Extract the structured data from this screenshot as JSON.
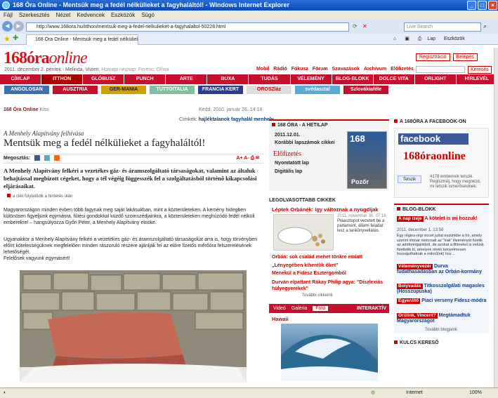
{
  "window": {
    "title": "168 Óra Online - Mentsük meg a fedél nélkülieket a fagyhaláltól! - Windows Internet Explorer"
  },
  "menu": [
    "Fájl",
    "Szerkesztés",
    "Nézet",
    "Kedvencek",
    "Eszközök",
    "Súgó"
  ],
  "address": {
    "url": "http://www.168ora.hu/itthon/mentsuk-meg-a-fedel-nelkulieket-a-fagyhalaltol-50228.html",
    "search_placeholder": "Live Search"
  },
  "tab": {
    "label": "168 Óra Online - Mentsük meg a fedél nélkülieket a fa..."
  },
  "toolbar": {
    "lap": "Lap",
    "eszkozok": "Eszközök"
  },
  "site": {
    "logo_main": "168óra",
    "logo_sub": "online",
    "dateline": "2011. december 2. péntek - Melinda, Vivien.",
    "namedays": "Holnapi névnap: Ferenc, Olívia",
    "top_links": [
      "Mobil",
      "Rádió",
      "Fókusz",
      "Fórum",
      "Szavazások",
      "Archívum",
      "Előfizetés"
    ],
    "regisztracio": "Regisztráció",
    "belepes": "Belépés",
    "kereses": "Keresés",
    "nav": [
      "CÍMLAP",
      "ITTHON",
      "GLÓBUSZ",
      "PUNCH",
      "ARTE",
      "BUXA",
      "TUDÁS",
      "VÉLEMÉNY",
      "BLOG-BLOKK",
      "DOLCE VITA",
      "ORLIGHT",
      "HÍRLEVÉL"
    ],
    "partners": [
      "ANGOLOSAN",
      "AUSZTRIA",
      "GER-MANIA",
      "TUTTOITALIA",
      "FRANCIA KERT",
      "OROSZláz",
      "svédasztal",
      "Szlovákiaféle"
    ]
  },
  "article": {
    "source": "168 Óra Online",
    "source_suffix": "Kiss",
    "datetime": "Kedd, 2010. január 26. 14:18",
    "cimkek_label": "Címkék:",
    "cimkek": "hajléktalanok fagyhalál menhely",
    "kicker": "A Menhely Alapítvány felhívása",
    "headline": "Mentsük meg a fedél nélkülieket a fagyhaláltól!",
    "share_label": "Megosztás:",
    "lead": "A Menhely Alapítvány felkéri a vezetékes gáz- és áramszolgáltató társaságokat, valamint az általuk behajtással megbízott cégeket, hogy a tél végéig függesszék fel a szolgáltatásból történő kikapcsolási eljárásaikat.",
    "more": "a cikk folytatódik a hirdetés után",
    "body1": "Magyarországon minden évben több fagynak meg saját lakásukban, mint a közterületeken. A kemény hidegben különösen figyeljünk egymásra, fűtési gondokkal küzdő szomszédjainkra, a közterületeken meghúzódó fedél nélküli emberekre! – hangsúlyozza Győri Péter, a Menhely Alapítvány elnöke.",
    "body2": "Ugyanakkor a Menhely Alapítvány felkéri a vezetékes gáz- és áramszolgáltató társaságokat arra is, hogy törvényben előírt kötelességüknek megfelelően minden rászoruló részére ajánlják fel az előre fizetős mérőóra felszerelésének lehetőségét.",
    "body3": "Felelősek vagyunk egymásért!"
  },
  "hetilap": {
    "title": "168 ÓRA - A HETILAP",
    "date": "2011.12.01.",
    "korabbi": "Korábbi lapszámok cikkei",
    "elofizetes": "Előfizetés",
    "nyomtatott": "Nyomtatott lap",
    "digitalis": "Digitális lap",
    "mag_title": "168",
    "mag_bottom": "Pozőr"
  },
  "legolvasottabb": {
    "title": "LEGOLVASOTTABB CIKKEK",
    "top_title": "Léptek Orbánék: így változnak a nyugdíjak",
    "top_date": "2011. november 30. 07:16",
    "top_text": "Pláasztopot vezetett be a parlament, állami feladat lesz a tankönyvellátás.",
    "items": [
      "Orbán: sok család mehet tönkre emiatt",
      "„Lényegében kiherélik őket”",
      "Menekül a Fidesz Esztergomból",
      "Durván elpattant Rákay Philip agya: \"Diszlexiás hülyegyerekek\""
    ],
    "tovabbi": "További cikkeink"
  },
  "media": {
    "tabs": [
      "Videó",
      "Galéria",
      "Fotó"
    ],
    "interaktiv": "INTERAKTÍV",
    "hawaii": "Hawaii"
  },
  "facebook": {
    "head": "A 168ÓRA A FACEBOOK-ON",
    "logo": "facebook",
    "brand": "168óraonline",
    "like": "Tetszik",
    "text": "4178 embernek tetszik. Regisztrálj, hogy megnézd, mi tetszik ismerőseidnek."
  },
  "blog": {
    "title": "BLOG-BLOKK",
    "t1": "A nap ízeje",
    "l1": "A kötelet is mi hozzuk!",
    "date": "2011. december 1. 13:58",
    "text": "Egy régies-régi viccet juttat eszünkbe a hír, amely szerint immár nemcsak az \"Irak\" illetményét fizetik az adóforintjainkból, de azokat a filléreket is velünk fizettetik ki, amelyek révén kényelmesen hozzájuthatnak a miknű(nk) hoz ...",
    "entries": [
      {
        "tag": "Véleményvezér",
        "title": "Durva tudathasadásban az Orbán-kormány"
      },
      {
        "tag": "Bolyvadás",
        "title": "Titkosszolgálati magasles (Hosszúpuska)"
      },
      {
        "tag": "Egyenlítő",
        "title": "Piaci verseny Fidesz-módra"
      },
      {
        "tag": "Őrülink, Vincent?",
        "title": "Megtámadtuk Magyarországot"
      }
    ],
    "tovabbi": "További blogjaink"
  },
  "kulcs": "KULCS KERESŐ",
  "status": {
    "zone": "Internet",
    "zoom": "100%"
  }
}
